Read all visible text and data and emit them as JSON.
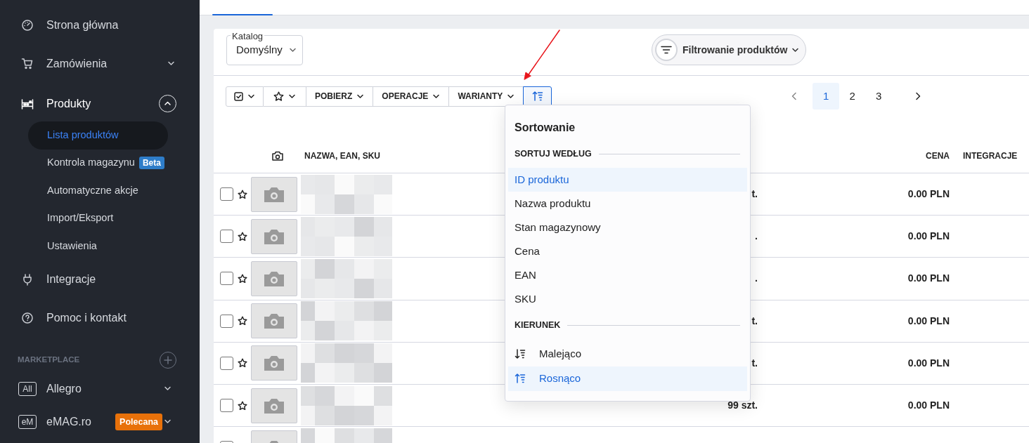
{
  "sidebar": {
    "items": [
      {
        "label": "Strona główna"
      },
      {
        "label": "Zamówienia",
        "expanded": false
      },
      {
        "label": "Produkty",
        "expanded": true,
        "children": [
          {
            "label": "Lista produktów",
            "selected": true
          },
          {
            "label": "Kontrola magazynu",
            "selected": false,
            "badge": "Beta"
          },
          {
            "label": "Automatyczne akcje",
            "selected": false
          },
          {
            "label": "Import/Eksport",
            "selected": false
          },
          {
            "label": "Ustawienia",
            "selected": false
          }
        ]
      },
      {
        "label": "Integracje"
      },
      {
        "label": "Pomoc i kontakt"
      }
    ],
    "marketplace": {
      "heading": "MARKETPLACE",
      "items": [
        {
          "logo": "All",
          "label": "Allegro",
          "expanded": false
        },
        {
          "logo": "eM",
          "label": "eMAG.ro",
          "badge": "Polecana",
          "expanded": false
        }
      ]
    }
  },
  "catalog": {
    "label": "Katalog",
    "value": "Domyślny"
  },
  "filter_button": {
    "label": "Filtrowanie produktów"
  },
  "toolbar": [
    {
      "kind": "select"
    },
    {
      "kind": "favorite"
    },
    {
      "kind": "menu",
      "label": "POBIERZ"
    },
    {
      "kind": "menu",
      "label": "OPERACJE"
    },
    {
      "kind": "menu",
      "label": "WARIANTY"
    },
    {
      "kind": "sort",
      "active": true
    }
  ],
  "pagination": {
    "pages": [
      {
        "label": "1",
        "selected": true
      },
      {
        "label": "2",
        "selected": false
      },
      {
        "label": "3",
        "selected": false
      }
    ]
  },
  "table": {
    "columns": [
      "NAZWA, EAN, SKU",
      "CENA",
      "INTEGRACJE"
    ],
    "rows": [
      {
        "checked": false,
        "favorite": false,
        "stock": "t.",
        "price": "0.00 PLN"
      },
      {
        "checked": false,
        "favorite": false,
        "stock": ".",
        "price": "0.00 PLN"
      },
      {
        "checked": false,
        "favorite": false,
        "stock": ".",
        "price": "0.00 PLN"
      },
      {
        "checked": false,
        "favorite": false,
        "stock": "t.",
        "price": "0.00 PLN"
      },
      {
        "checked": false,
        "favorite": false,
        "stock": "t.",
        "price": "0.00 PLN"
      },
      {
        "checked": false,
        "favorite": false,
        "stock": "99 szt.",
        "price": "0.00 PLN"
      },
      {
        "checked": false
      }
    ]
  },
  "sort_menu": {
    "title": "Sortowanie",
    "sections": [
      {
        "heading": "SORTUJ WEDŁUG",
        "options": [
          {
            "label": "ID produktu",
            "selected": true
          },
          {
            "label": "Nazwa produktu",
            "selected": false
          },
          {
            "label": "Stan magazynowy",
            "selected": false
          },
          {
            "label": "Cena",
            "selected": false
          },
          {
            "label": "EAN",
            "selected": false
          },
          {
            "label": "SKU",
            "selected": false
          }
        ]
      },
      {
        "heading": "KIERUNEK",
        "options": [
          {
            "label": "Malejąco",
            "selected": false,
            "kind": "desc"
          },
          {
            "label": "Rosnąco",
            "selected": true,
            "kind": "asc"
          }
        ]
      }
    ]
  }
}
